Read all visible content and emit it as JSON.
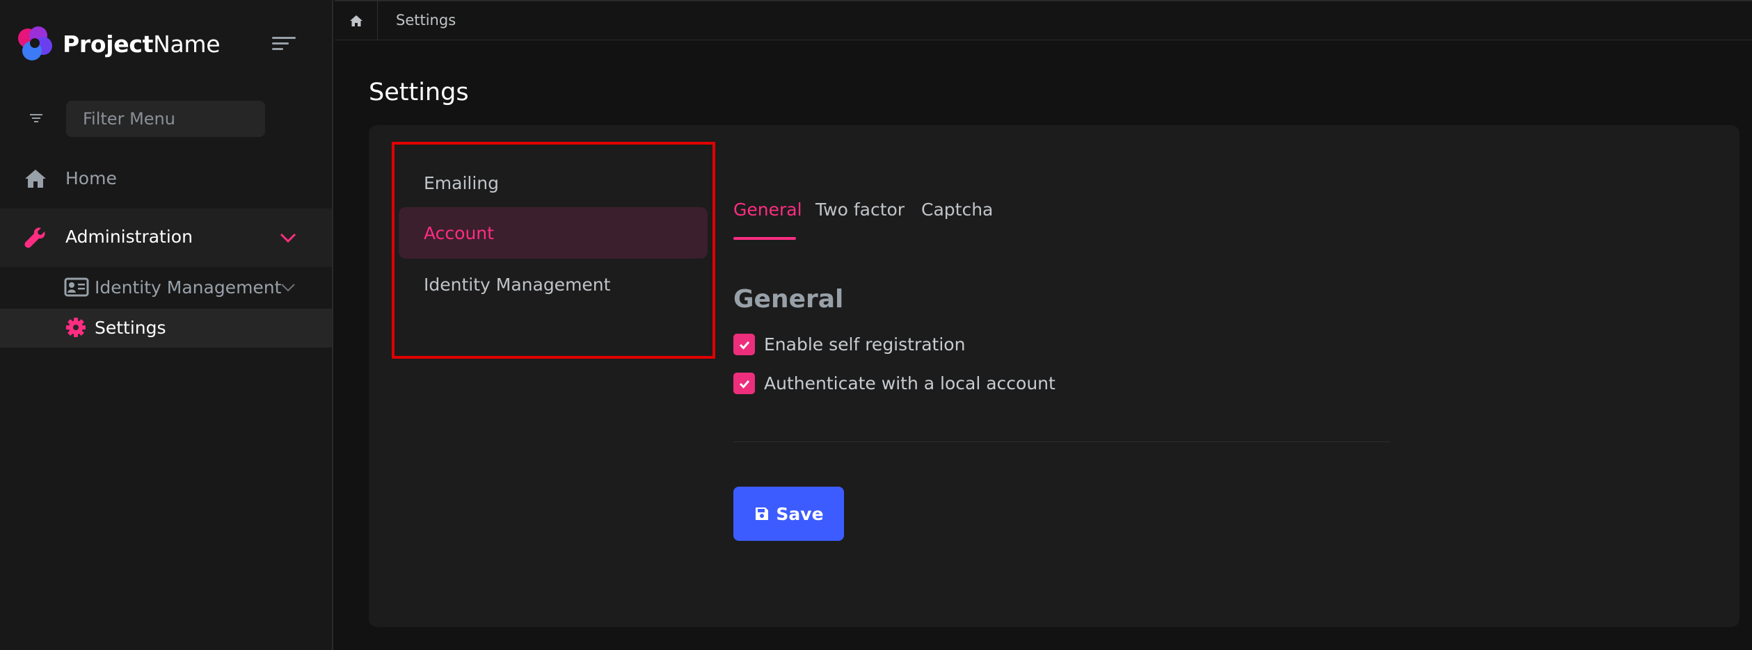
{
  "brand": {
    "name_bold": "Project",
    "name_light": "Name"
  },
  "sidebar": {
    "filter_placeholder": "Filter Menu",
    "items": [
      {
        "label": "Home",
        "icon": "home-icon"
      },
      {
        "label": "Administration",
        "icon": "wrench-icon",
        "expanded": true
      },
      {
        "label": "Identity Management",
        "icon": "id-card-icon"
      },
      {
        "label": "Settings",
        "icon": "gear-icon",
        "active": true
      }
    ]
  },
  "breadcrumb": {
    "home_icon": "home-icon",
    "current": "Settings"
  },
  "page": {
    "title": "Settings"
  },
  "settings_menu": {
    "items": [
      {
        "label": "Emailing"
      },
      {
        "label": "Account",
        "active": true
      },
      {
        "label": "Identity Management"
      }
    ]
  },
  "tabs": [
    {
      "label": "General",
      "active": true
    },
    {
      "label": "Two factor"
    },
    {
      "label": "Captcha"
    }
  ],
  "general": {
    "title": "General",
    "options": [
      {
        "label": "Enable self registration",
        "checked": true
      },
      {
        "label": "Authenticate with a local account",
        "checked": true
      }
    ]
  },
  "actions": {
    "save_label": "Save"
  },
  "colors": {
    "accent": "#ff2d82",
    "primary_button": "#3d5cff",
    "highlight_border": "#e00000",
    "background": "#121212",
    "card": "#1c1c1c"
  }
}
